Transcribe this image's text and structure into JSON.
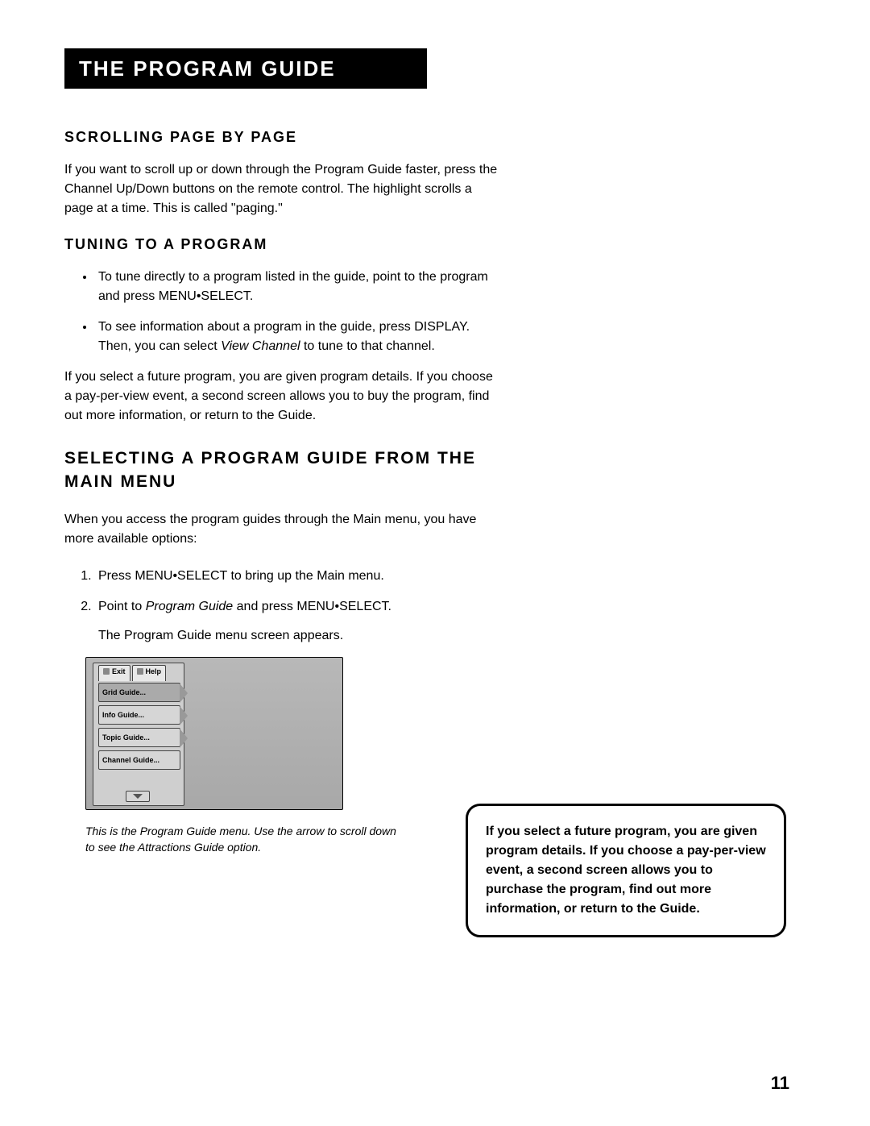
{
  "title_bar": "The Program Guide",
  "sec1": {
    "heading": "Scrolling Page by Page",
    "para": "If you want to scroll up or down through the Program Guide faster, press the Channel Up/Down buttons on the remote control. The highlight scrolls a page at a time. This is called \"paging.\""
  },
  "sec2": {
    "heading": "Tuning to a Program",
    "bullet1": "To tune directly to a program listed in the guide, point to the program and press MENU•SELECT.",
    "bullet2_a": "To see information about a program in the guide, press DISPLAY. Then, you can select ",
    "bullet2_ital": "View Channel",
    "bullet2_b": " to tune to that channel.",
    "para": "If you select a future program, you are given program details. If you choose a pay-per-view event, a second screen allows you to buy the program, find out more information, or return to the Guide."
  },
  "sec3": {
    "heading": "Selecting a Program Guide from the Main Menu",
    "intro": "When you access the program guides through the Main menu, you have more available options:",
    "step1": "Press MENU•SELECT to bring up the Main menu.",
    "step2_a": "Point to ",
    "step2_ital": "Program Guide",
    "step2_b": " and press MENU•SELECT.",
    "step2_sub": "The Program Guide menu screen appears."
  },
  "menu": {
    "tab_exit": "Exit",
    "tab_help": "Help",
    "item1": "Grid Guide...",
    "item2": "Info Guide...",
    "item3": "Topic Guide...",
    "item4": "Channel Guide..."
  },
  "caption": "This is the Program Guide menu. Use the arrow to scroll down to see the Attractions Guide option.",
  "callout": "If you select a future program, you are given program details. If you choose a pay-per-view event, a second screen allows you to purchase the program, find out more information, or return to the Guide.",
  "page_number": "11"
}
